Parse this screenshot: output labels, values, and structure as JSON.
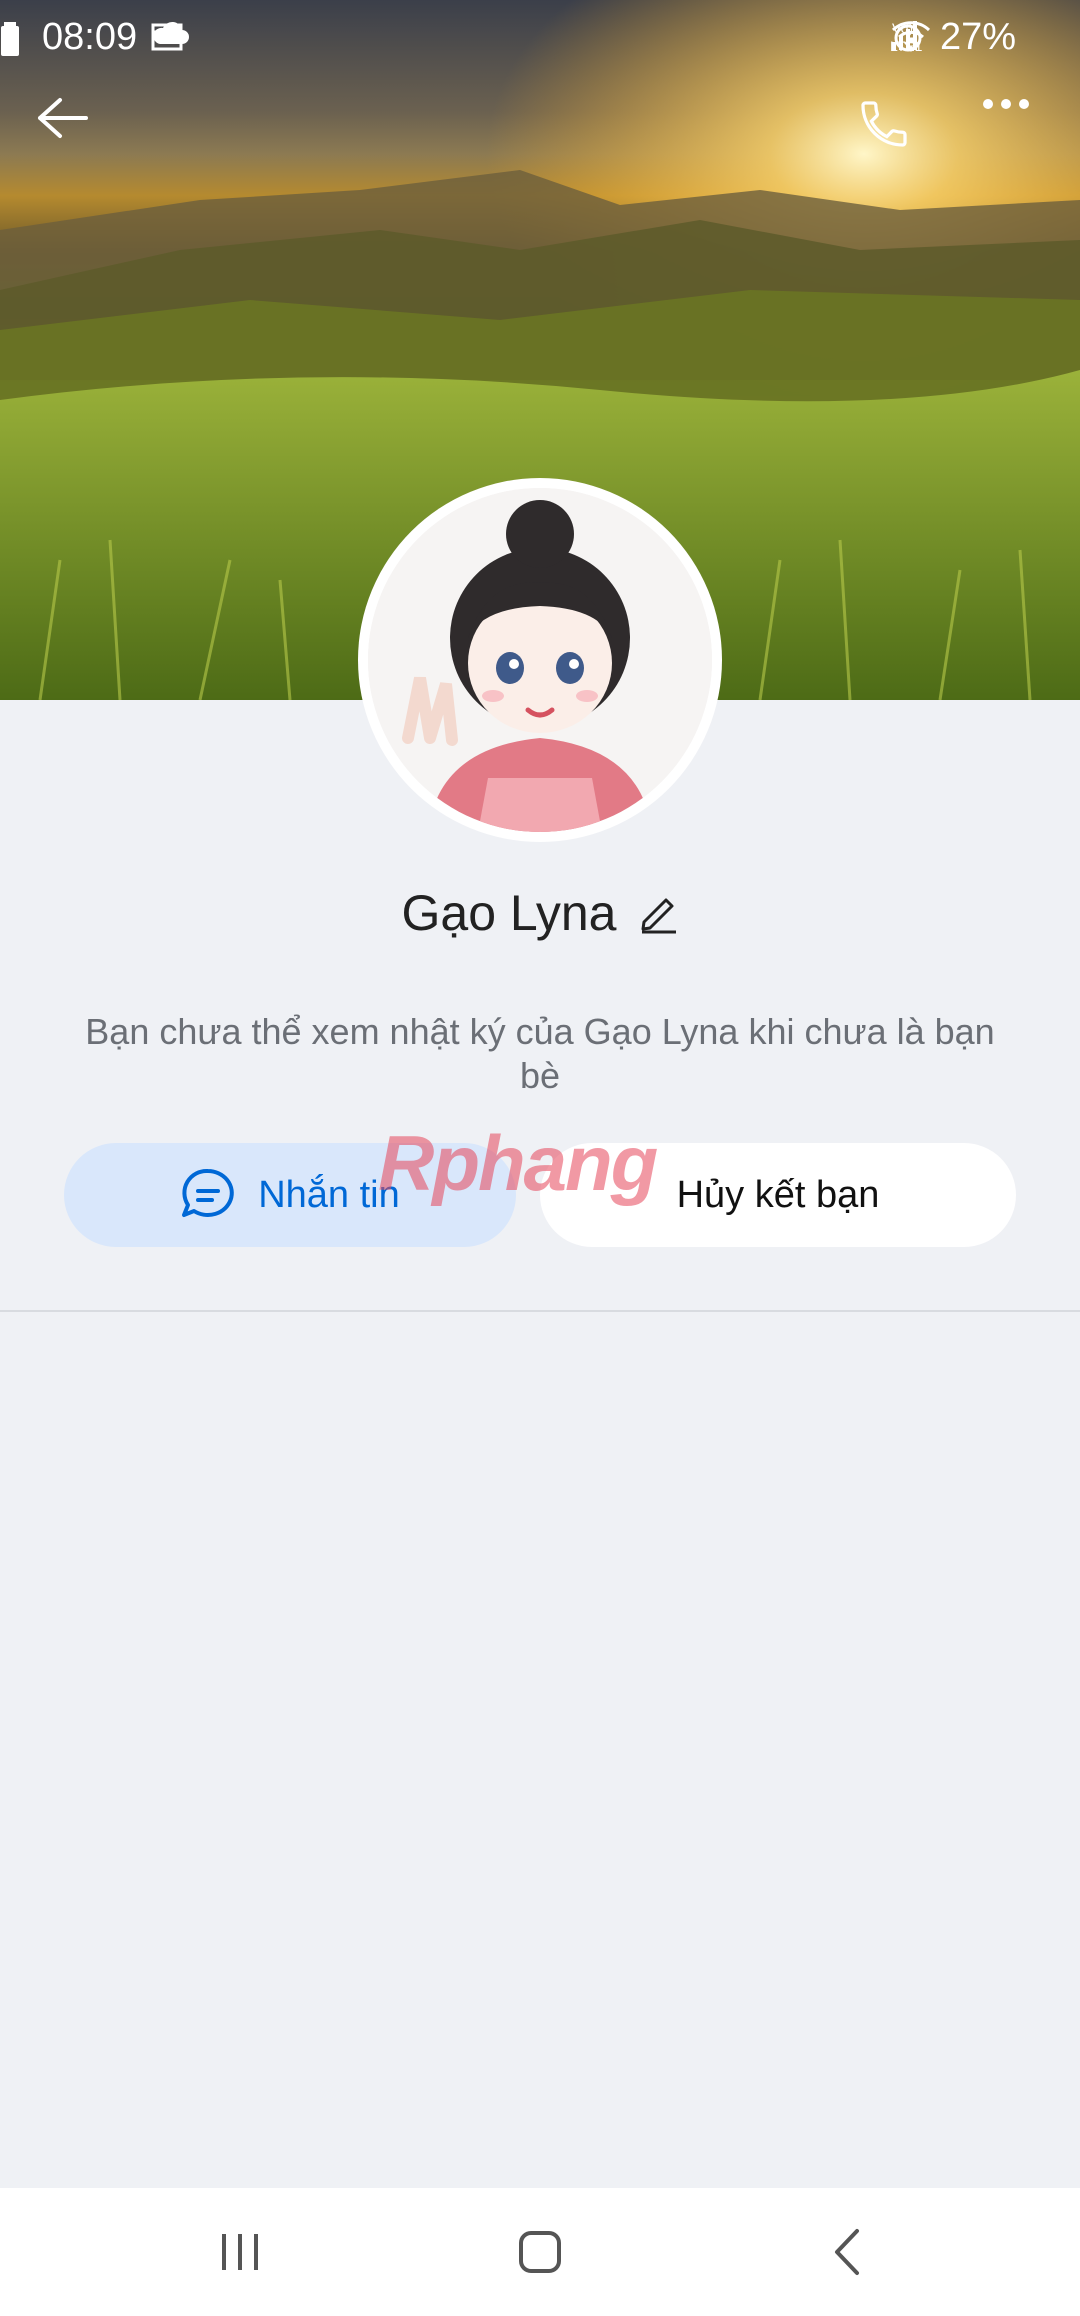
{
  "status_bar": {
    "time": "08:09",
    "battery": "27%",
    "icons": [
      "cloud-icon",
      "calendar-icon",
      "alarm-icon",
      "wifi-icon",
      "volte-icon",
      "signal-icon",
      "battery-icon"
    ]
  },
  "header": {
    "back_icon": "arrow-left-icon",
    "call_icon": "phone-icon",
    "more_icon": "more-horizontal-icon"
  },
  "profile": {
    "name": "Gạo Lyna",
    "edit_icon": "pencil-icon",
    "info_text": "Bạn chưa thể xem nhật ký của Gạo Lyna khi chưa là bạn bè"
  },
  "actions": {
    "message_label": "Nhắn tin",
    "message_icon": "chat-bubble-icon",
    "unfriend_label": "Hủy kết bạn"
  },
  "watermark": "Rphang",
  "colors": {
    "accent": "#0068d6",
    "message_button_bg": "#d9e7fb",
    "page_bg": "#eff1f5"
  },
  "nav": {
    "recents_icon": "recents-icon",
    "home_icon": "home-icon",
    "back_icon": "chevron-left-icon"
  }
}
